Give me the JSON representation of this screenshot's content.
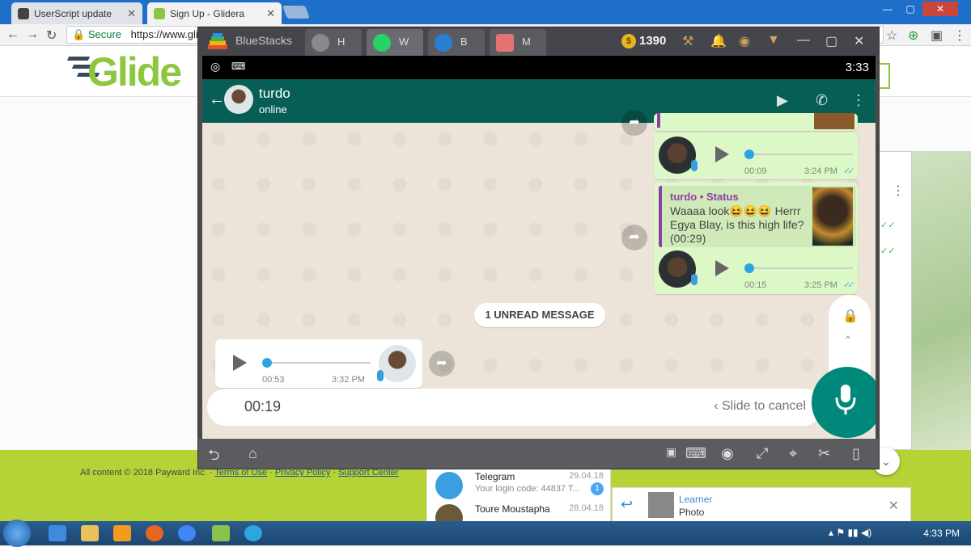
{
  "browser": {
    "tabs": [
      {
        "title": "UserScript update"
      },
      {
        "title": "Sign Up - Glidera"
      }
    ],
    "secure_label": "Secure",
    "url": "https://www.glic"
  },
  "glidera": {
    "logo_text": "Glide",
    "footer_copyright": "All content © 2018 Payward Inc. ·",
    "footer_links": [
      "Terms of Use",
      "Privacy Policy",
      "Support Center"
    ]
  },
  "telegram": {
    "chats": [
      {
        "name": "Telegram",
        "date": "29.04.18",
        "preview": "Your login code: 44837  T...",
        "badge": "1"
      },
      {
        "name": "Toure Moustapha",
        "date": "28.04.18",
        "preview": ""
      }
    ],
    "reply": {
      "name": "Learner",
      "type": "Photo"
    }
  },
  "bluestacks": {
    "title": "BlueStacks",
    "tabs": [
      {
        "label": "H",
        "icon": "home-icon"
      },
      {
        "label": "W",
        "icon": "whatsapp-icon"
      },
      {
        "label": "B",
        "icon": "browser-icon"
      },
      {
        "label": "M",
        "icon": "mail-icon"
      }
    ],
    "coins": "1390"
  },
  "android": {
    "clock": "3:33"
  },
  "whatsapp": {
    "contact_name": "turdo",
    "contact_status": "online",
    "messages": [
      {
        "duration": "00:09",
        "time": "3:24 PM"
      },
      {
        "quote_name": "turdo • Status",
        "quote_text": "Waaaa look😆😆😆 Herrr Egya Blay, is this high life? (00:29)",
        "duration": "00:15",
        "time": "3:25 PM"
      }
    ],
    "unread_label": "1 UNREAD MESSAGE",
    "incoming": {
      "duration": "00:53",
      "time": "3:32 PM"
    },
    "recording": {
      "elapsed": "00:19",
      "slide_hint": "Slide to cancel"
    }
  },
  "taskbar": {
    "time": "4:33 PM"
  },
  "colors": {
    "whatsapp_header": "#075e54",
    "bubble_out": "#dcf8c6",
    "glidera_green": "#8dc63f",
    "chrome_frame": "#1d6fc9"
  }
}
